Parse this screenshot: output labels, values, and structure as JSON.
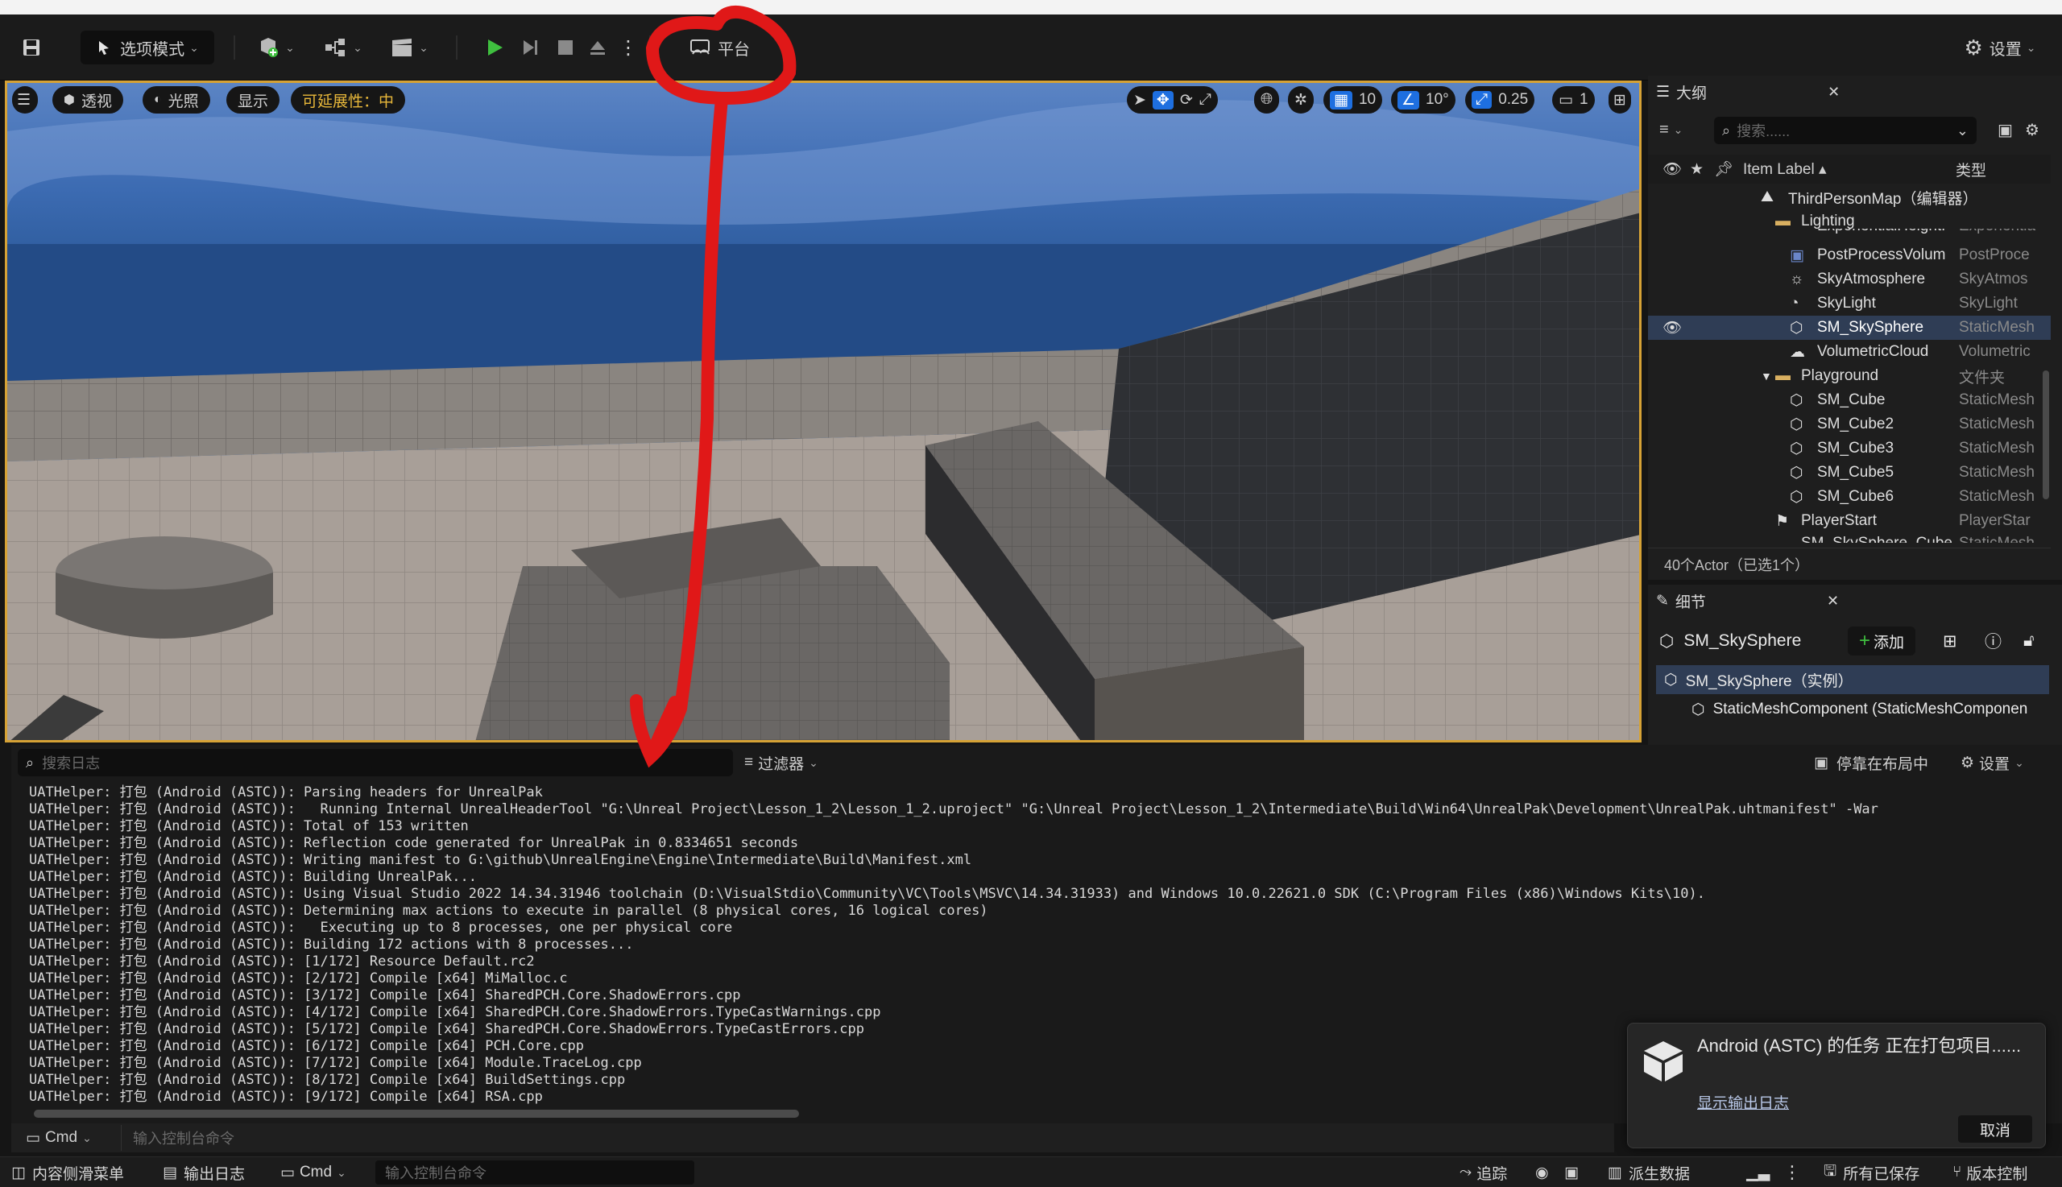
{
  "toolbar": {
    "mode_label": "选项模式",
    "platform_label": "平台",
    "settings_label": "设置"
  },
  "viewport": {
    "perspective_label": "透视",
    "lighting_label": "光照",
    "show_label": "显示",
    "scalability_label": "可延展性：中",
    "grid_snap_value": "10",
    "rotation_snap_value": "10°",
    "scale_snap_value": "0.25",
    "camera_speed_value": "1"
  },
  "outliner": {
    "tab_label": "大纲",
    "search_placeholder": "搜索......",
    "column_item_label": "Item Label",
    "column_type_label": "类型",
    "rows": [
      {
        "label": "ThirdPersonMap（编辑器）",
        "type": ""
      },
      {
        "label": "Lighting",
        "type": ""
      },
      {
        "label": "ExponentialHeightF",
        "type": "Exponentia"
      },
      {
        "label": "PostProcessVolum",
        "type": "PostProce"
      },
      {
        "label": "SkyAtmosphere",
        "type": "SkyAtmos"
      },
      {
        "label": "SkyLight",
        "type": "SkyLight"
      },
      {
        "label": "SM_SkySphere",
        "type": "StaticMesh"
      },
      {
        "label": "VolumetricCloud",
        "type": "Volumetric"
      },
      {
        "label": "Playground",
        "type": "文件夹"
      },
      {
        "label": "SM_Cube",
        "type": "StaticMesh"
      },
      {
        "label": "SM_Cube2",
        "type": "StaticMesh"
      },
      {
        "label": "SM_Cube3",
        "type": "StaticMesh"
      },
      {
        "label": "SM_Cube5",
        "type": "StaticMesh"
      },
      {
        "label": "SM_Cube6",
        "type": "StaticMesh"
      },
      {
        "label": "PlayerStart",
        "type": "PlayerStar"
      },
      {
        "label": "SM_SkySphere_Cube",
        "type": "StaticMesh"
      }
    ],
    "footer": "40个Actor（已选1个）"
  },
  "details": {
    "tab_label": "细节",
    "object_name": "SM_SkySphere",
    "add_label": "添加",
    "instance_label": "SM_SkySphere（实例）",
    "component_label": "StaticMeshComponent (StaticMeshComponen"
  },
  "log": {
    "search_placeholder": "搜索日志",
    "filter_label": "过滤器",
    "dock_label": "停靠在布局中",
    "settings_label": "设置",
    "lines": [
      "UATHelper: 打包 (Android (ASTC)): Parsing headers for UnrealPak",
      "UATHelper: 打包 (Android (ASTC)):   Running Internal UnrealHeaderTool \"G:\\Unreal Project\\Lesson_1_2\\Lesson_1_2.uproject\" \"G:\\Unreal Project\\Lesson_1_2\\Intermediate\\Build\\Win64\\UnrealPak\\Development\\UnrealPak.uhtmanifest\" -War",
      "UATHelper: 打包 (Android (ASTC)): Total of 153 written",
      "UATHelper: 打包 (Android (ASTC)): Reflection code generated for UnrealPak in 0.8334651 seconds",
      "UATHelper: 打包 (Android (ASTC)): Writing manifest to G:\\github\\UnrealEngine\\Engine\\Intermediate\\Build\\Manifest.xml",
      "UATHelper: 打包 (Android (ASTC)): Building UnrealPak...",
      "UATHelper: 打包 (Android (ASTC)): Using Visual Studio 2022 14.34.31946 toolchain (D:\\VisualStdio\\Community\\VC\\Tools\\MSVC\\14.34.31933) and Windows 10.0.22621.0 SDK (C:\\Program Files (x86)\\Windows Kits\\10).",
      "UATHelper: 打包 (Android (ASTC)): Determining max actions to execute in parallel (8 physical cores, 16 logical cores)",
      "UATHelper: 打包 (Android (ASTC)):   Executing up to 8 processes, one per physical core",
      "UATHelper: 打包 (Android (ASTC)): Building 172 actions with 8 processes...",
      "UATHelper: 打包 (Android (ASTC)): [1/172] Resource Default.rc2",
      "UATHelper: 打包 (Android (ASTC)): [2/172] Compile [x64] MiMalloc.c",
      "UATHelper: 打包 (Android (ASTC)): [3/172] Compile [x64] SharedPCH.Core.ShadowErrors.cpp",
      "UATHelper: 打包 (Android (ASTC)): [4/172] Compile [x64] SharedPCH.Core.ShadowErrors.TypeCastWarnings.cpp",
      "UATHelper: 打包 (Android (ASTC)): [5/172] Compile [x64] SharedPCH.Core.ShadowErrors.TypeCastErrors.cpp",
      "UATHelper: 打包 (Android (ASTC)): [6/172] Compile [x64] PCH.Core.cpp",
      "UATHelper: 打包 (Android (ASTC)): [7/172] Compile [x64] Module.TraceLog.cpp",
      "UATHelper: 打包 (Android (ASTC)): [8/172] Compile [x64] BuildSettings.cpp",
      "UATHelper: 打包 (Android (ASTC)): [9/172] Compile [x64] RSA.cpp"
    ],
    "cmd_label": "Cmd",
    "cmd_placeholder": "输入控制台命令"
  },
  "toast": {
    "title": "Android (ASTC) 的任务 正在打包项目......",
    "link": "显示输出日志",
    "cancel": "取消"
  },
  "statusbar": {
    "content_drawer": "内容侧滑菜单",
    "output_log": "输出日志",
    "cmd_label": "Cmd",
    "cmd_placeholder": "输入控制台命令",
    "trace": "追踪",
    "derived_data": "派生数据",
    "all_saved": "所有已保存",
    "source_control": "版本控制"
  },
  "colors": {
    "selection_gold": "#d6a235",
    "accent_blue": "#1e6fe0",
    "play_green": "#3fbf3f",
    "annotation_red": "#e01818"
  }
}
